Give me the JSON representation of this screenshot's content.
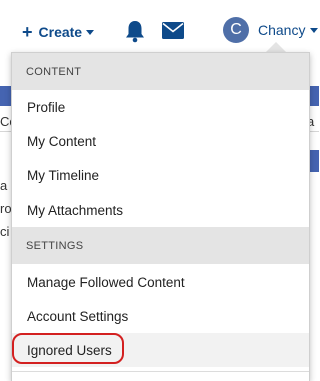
{
  "topbar": {
    "create_label": "Create",
    "user_initial": "C",
    "user_name": "Chancy"
  },
  "background": {
    "tab_fragment_left": "Co",
    "tab_fragment_right": "a",
    "text_line1": "a",
    "text_line2": "ro",
    "text_line3": "ci"
  },
  "menu": {
    "content_header": "CONTENT",
    "content_items": [
      "Profile",
      "My Content",
      "My Timeline",
      "My Attachments"
    ],
    "settings_header": "SETTINGS",
    "settings_items": [
      "Manage Followed Content",
      "Account Settings",
      "Ignored Users"
    ]
  },
  "colors": {
    "brand": "#0e4a8a",
    "avatar": "#4f6fa8",
    "highlight_circle": "#d32020"
  }
}
